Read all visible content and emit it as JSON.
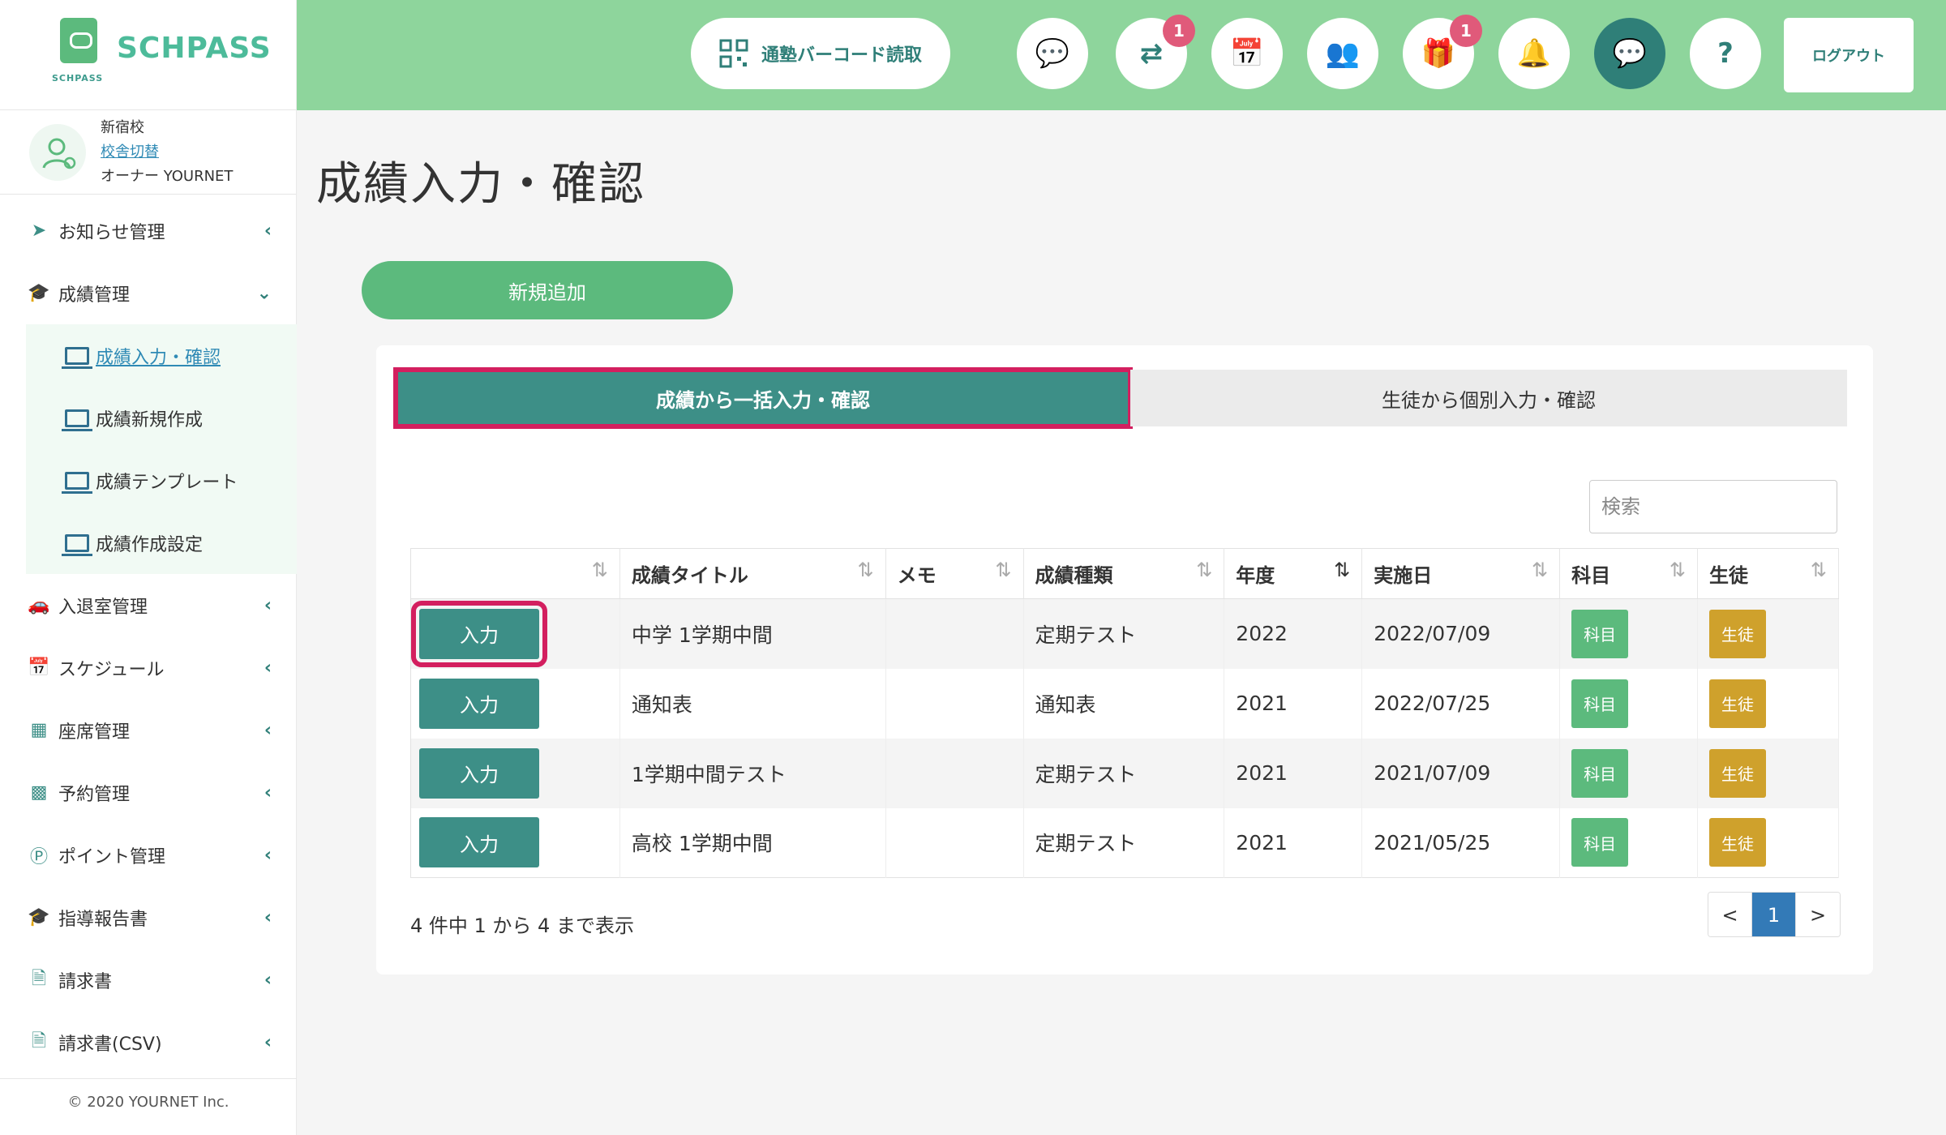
{
  "brand": {
    "name": "SCHPASS",
    "small": "SCHPASS"
  },
  "school": {
    "name": "新宿校",
    "switch_label": "校舎切替",
    "owner": "オーナー YOURNET"
  },
  "sidebar": {
    "items": [
      {
        "label": "お知らせ管理"
      },
      {
        "label": "成績管理"
      },
      {
        "label": "入退室管理"
      },
      {
        "label": "スケジュール"
      },
      {
        "label": "座席管理"
      },
      {
        "label": "予約管理"
      },
      {
        "label": "ポイント管理"
      },
      {
        "label": "指導報告書"
      },
      {
        "label": "請求書"
      },
      {
        "label": "請求書(CSV)"
      }
    ],
    "subitems": [
      {
        "label": "成績入力・確認"
      },
      {
        "label": "成績新規作成"
      },
      {
        "label": "成績テンプレート"
      },
      {
        "label": "成績作成設定"
      }
    ],
    "copyright": "© 2020 YOURNET Inc."
  },
  "header": {
    "barcode_label": "通塾バーコード読取",
    "badges": {
      "transfer": "1",
      "gift": "1"
    },
    "help": "?",
    "logout_label": "ログアウト"
  },
  "main": {
    "title": "成績入力・確認",
    "add_label": "新規追加",
    "tabs": [
      {
        "label": "成績から一括入力・確認"
      },
      {
        "label": "生徒から個別入力・確認"
      }
    ],
    "search_placeholder": "検索",
    "columns": [
      "",
      "成績タイトル",
      "メモ",
      "成績種類",
      "年度",
      "実施日",
      "科目",
      "生徒"
    ],
    "rows": [
      {
        "action": "入力",
        "title": "中学 1学期中間",
        "memo": "",
        "type": "定期テスト",
        "year": "2022",
        "date": "2022/07/09",
        "subject": "科目",
        "student": "生徒"
      },
      {
        "action": "入力",
        "title": "通知表",
        "memo": "",
        "type": "通知表",
        "year": "2021",
        "date": "2022/07/25",
        "subject": "科目",
        "student": "生徒"
      },
      {
        "action": "入力",
        "title": "1学期中間テスト",
        "memo": "",
        "type": "定期テスト",
        "year": "2021",
        "date": "2021/07/09",
        "subject": "科目",
        "student": "生徒"
      },
      {
        "action": "入力",
        "title": "高校 1学期中間",
        "memo": "",
        "type": "定期テスト",
        "year": "2021",
        "date": "2021/05/25",
        "subject": "科目",
        "student": "生徒"
      }
    ],
    "count_text": "4 件中 1 から 4 まで表示",
    "pager": {
      "prev": "<",
      "current": "1",
      "next": ">"
    }
  },
  "colors": {
    "header_bg": "#8ed59c",
    "accent": "#3d8f87",
    "green": "#5cba7d",
    "gold": "#cfa12c",
    "highlight": "#d31f5f"
  }
}
